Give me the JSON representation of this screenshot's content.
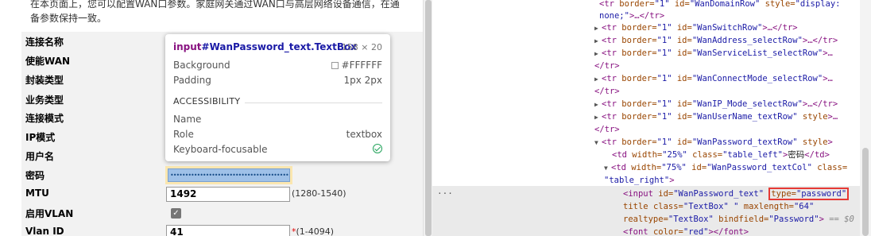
{
  "page": {
    "intro_line1": "在本页面上，您可以配置WAN口参数。家庭网关通过WAN口与高层网络设备通信，在通",
    "intro_line2": "备参数保持一致。",
    "form": {
      "rows": [
        {
          "label": "连接名称"
        },
        {
          "label": "使能WAN"
        },
        {
          "label": "封装类型"
        },
        {
          "label": "业务类型"
        },
        {
          "label": "连接模式"
        },
        {
          "label": "IP模式"
        },
        {
          "label": "用户名"
        },
        {
          "label": "密码"
        },
        {
          "label": "MTU",
          "value": "1492",
          "hint": "(1280-1540)"
        },
        {
          "label": "启用VLAN",
          "checked": true
        },
        {
          "label": "Vlan ID",
          "value": "41",
          "hint_req": "*",
          "hint": "(1-4094)"
        }
      ],
      "password_mask": "••••••••••••••••••••••••••••••••••••••••••••••"
    }
  },
  "tooltip": {
    "tag": "input",
    "rest": "#WanPassword_text.TextBox",
    "size": "158 × 20",
    "background_label": "Background",
    "background_value": "#FFFFFF",
    "padding_label": "Padding",
    "padding_value": "1px 2px",
    "accessibility_header": "ACCESSIBILITY",
    "name_label": "Name",
    "role_label": "Role",
    "role_value": "textbox",
    "focus_label": "Keyboard-focusable"
  },
  "devtools": {
    "ellipsis": "···",
    "lines": [
      {
        "indent": 0,
        "arrow": "",
        "html": [
          [
            "an",
            "\"1\" "
          ],
          [
            "an",
            "id="
          ],
          [
            "av",
            "\"WanDomainRow\" "
          ],
          [
            "an",
            "style="
          ],
          [
            "av",
            "\"display:"
          ]
        ],
        "prefix": [
          [
            "t",
            "<tr "
          ],
          [
            "an",
            "border="
          ]
        ]
      },
      {
        "indent": 0,
        "arrow": "",
        "text": [
          [
            "av",
            "none;\""
          ],
          [
            "t",
            ">…</tr>"
          ]
        ]
      },
      {
        "arrow": "▶",
        "tag": "tr",
        "id": "WanSwitchRow",
        "tail": ">…</tr>"
      },
      {
        "arrow": "▶",
        "tag": "tr",
        "id": "WanAddress_selectRow",
        "tail": ">…</tr>"
      },
      {
        "arrow": "▶",
        "tag": "tr",
        "id": "WanServiceList_selectRow",
        "tail": ">…"
      },
      {
        "close": "</tr>"
      },
      {
        "arrow": "▶",
        "tag": "tr",
        "id": "WanConnectMode_selectRow",
        "tail": ">…"
      },
      {
        "close": "</tr>"
      },
      {
        "arrow": "▶",
        "tag": "tr",
        "id": "WanIP_Mode_selectRow",
        "tail": ">…</tr>"
      },
      {
        "arrow": "▶",
        "tag": "tr",
        "id": "WanUserName_textRow",
        "tail": " style>…"
      },
      {
        "close": "</tr>"
      },
      {
        "arrow": "▼",
        "tag": "tr",
        "id": "WanPassword_textRow",
        "tail": " style>"
      }
    ],
    "td1": {
      "width": "\"25%\"",
      "class": "\"table_left\"",
      "text": "密码"
    },
    "td2": {
      "width": "\"75%\"",
      "id": "\"WanPassword_textCol\"",
      "class_start": "class=",
      "class_val": "\"table_right\""
    },
    "input_line": {
      "id": "\"WanPassword_text\"",
      "type": "\"password\""
    },
    "title_line": {
      "title": "title ",
      "class": "\"TextBox\"",
      "maxlength": "\"64\""
    },
    "realtype_line": {
      "realtype": "\"TextBox\"",
      "bindfield": "\"Password\"",
      "eq": "== $0"
    },
    "font_line": {
      "color": "\"red\""
    }
  }
}
